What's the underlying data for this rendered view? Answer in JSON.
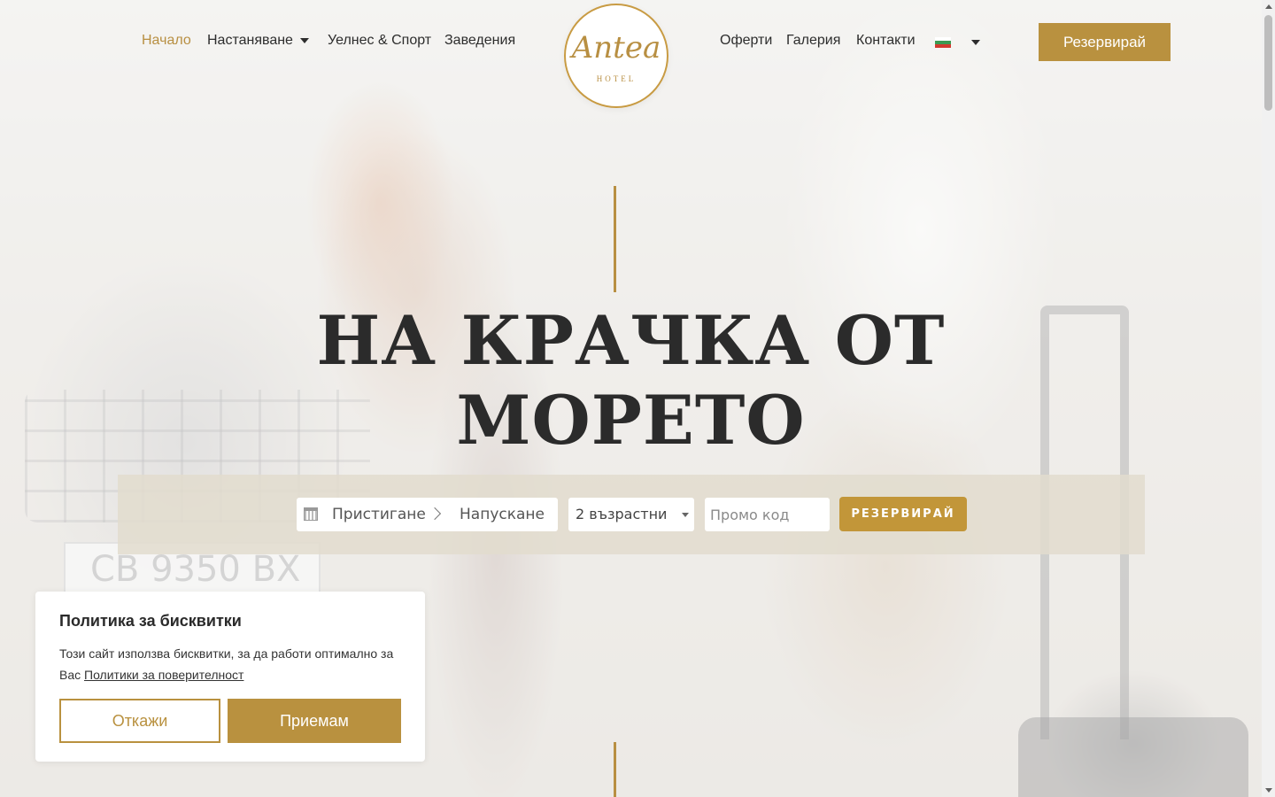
{
  "nav": {
    "left": [
      {
        "label": "Начало",
        "active": true
      },
      {
        "label": "Настаняване",
        "dropdown": true
      },
      {
        "label": "Уелнес & Спорт"
      },
      {
        "label": "Заведения"
      }
    ],
    "right": [
      {
        "label": "Оферти"
      },
      {
        "label": "Галерия"
      },
      {
        "label": "Контакти"
      }
    ],
    "language_flag": "bg-flag-icon",
    "reserve_label": "Резервирай"
  },
  "logo": {
    "script": "Antea",
    "sub": "HOTEL"
  },
  "hero": {
    "title_line1": "НА КРАЧКА ОТ",
    "title_line2": "МОРЕТО",
    "background_plate": "CB 9350 BX"
  },
  "booking": {
    "arrival": "Пристигане",
    "departure": "Напускане",
    "guests": "2 възрастни",
    "promo_placeholder": "Промо код",
    "button": "РЕЗЕРВИРАЙ"
  },
  "cookie": {
    "title": "Политика за бисквитки",
    "text": "Този сайт използва бисквитки, за да работи оптимално за Вас",
    "link": "Политики за поверителност",
    "reject": "Откажи",
    "accept": "Приемам"
  },
  "colors": {
    "accent": "#b9913f",
    "nav_active": "#b88f42",
    "text": "#2d2d2d"
  }
}
